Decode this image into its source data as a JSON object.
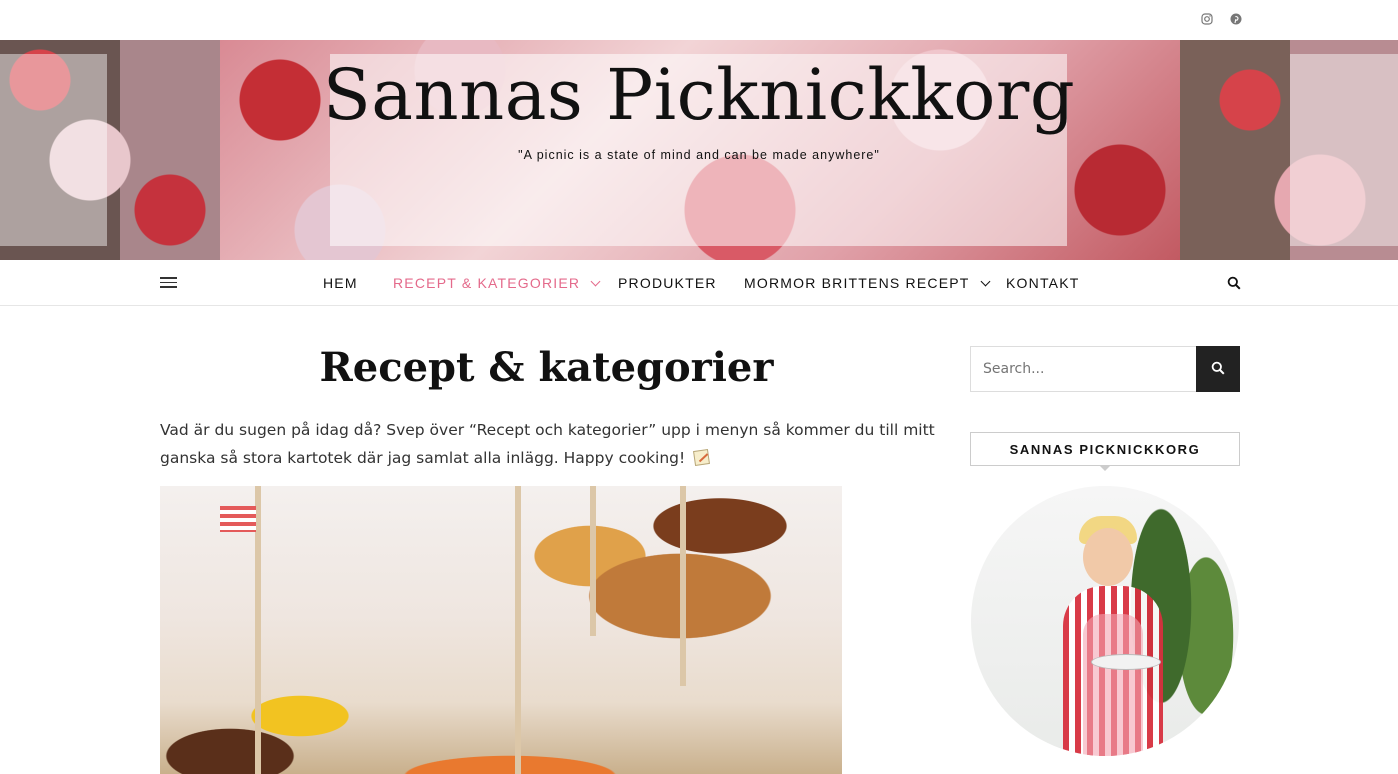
{
  "site": {
    "title": "Sannas Picknickkorg",
    "tagline": "\"A picnic is a state of mind and can be made anywhere\""
  },
  "social": {
    "instagram_icon": "instagram-icon",
    "pinterest_icon": "pinterest-icon"
  },
  "nav": {
    "items": [
      {
        "label": "HEM"
      },
      {
        "label": "RECEPT & KATEGORIER",
        "active": true,
        "dropdown": true
      },
      {
        "label": "PRODUKTER"
      },
      {
        "label": "MORMOR BRITTENS RECEPT",
        "dropdown": true
      },
      {
        "label": "KONTAKT"
      }
    ],
    "active_color": "#e46a8b"
  },
  "page": {
    "title": "Recept & kategorier",
    "intro": "Vad är du sugen på idag då? Svep över “Recept och kategorier” upp i menyn så kommer du till mitt ganska så stora kartotek där jag samlat alla inlägg. Happy cooking!"
  },
  "sidebar": {
    "search_placeholder": "Search...",
    "widget_title": "SANNAS PICKNICKKORG"
  }
}
